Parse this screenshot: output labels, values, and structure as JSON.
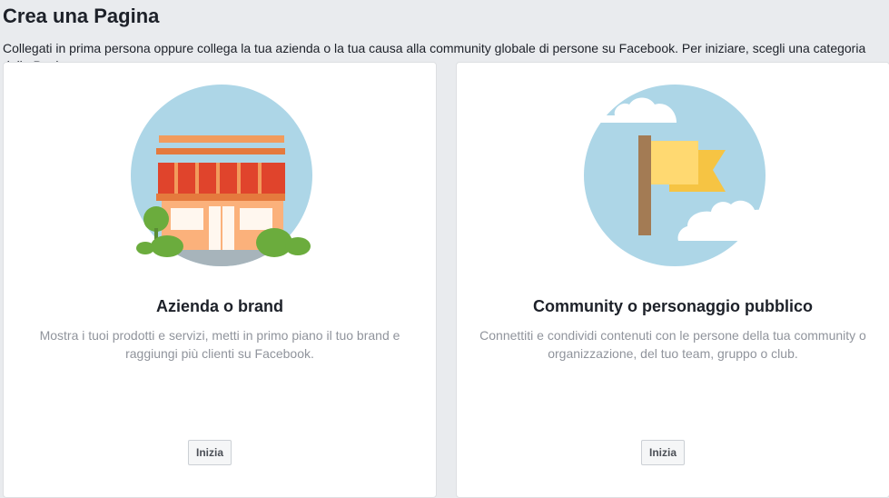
{
  "header": {
    "title": "Crea una Pagina",
    "description": "Collegati in prima persona oppure collega la tua azienda o la tua causa alla community globale di persone su Facebook. Per iniziare, scegli una categoria della Pagina."
  },
  "cards": [
    {
      "title": "Azienda o brand",
      "description": "Mostra i tuoi prodotti e servizi, metti in primo piano il tuo brand e raggiungi più clienti su Facebook.",
      "button_label": "Inizia",
      "icon": "storefront-illustration"
    },
    {
      "title": "Community o personaggio pubblico",
      "description": "Connettiti e condividi contenuti con le persone della tua community o organizzazione, del tuo team, gruppo o club.",
      "button_label": "Inizia",
      "icon": "flag-illustration"
    }
  ],
  "colors": {
    "background": "#e9ebee",
    "circle": "#add6e7",
    "awning_red": "#e0442c",
    "storefront_orange": "#fbb17b",
    "flag_yellow": "#ffd971",
    "flag_gold": "#f6c443",
    "pole_brown": "#a37b54",
    "bush_green": "#6bac3d"
  }
}
